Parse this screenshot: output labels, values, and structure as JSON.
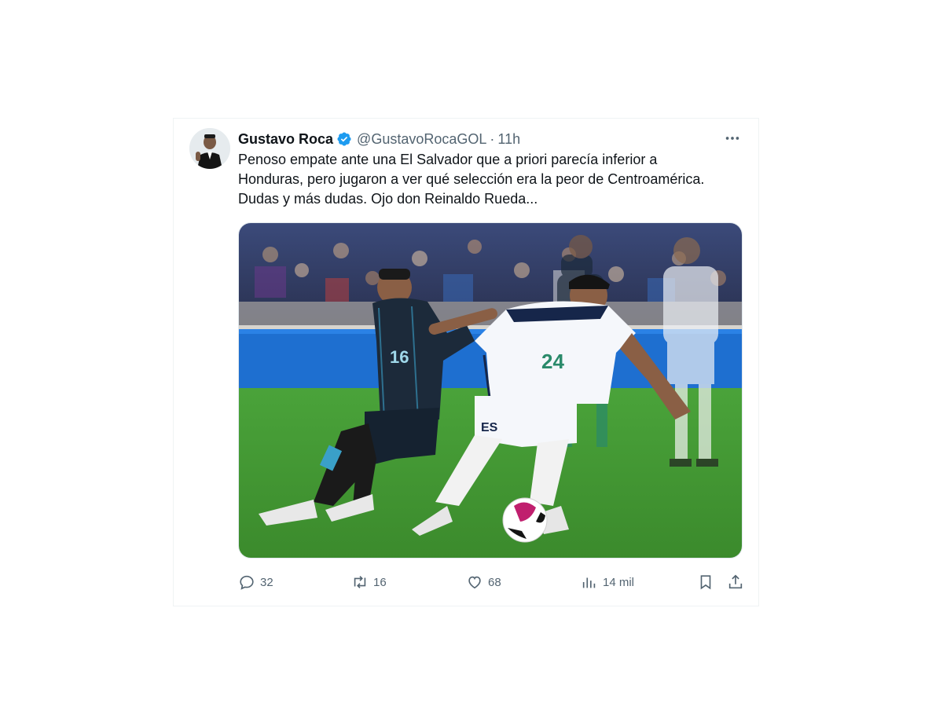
{
  "tweet": {
    "author_name": "Gustavo Roca",
    "handle": "@GustavoRocaGOL",
    "separator": "·",
    "time": "11h",
    "text_lines": [
      "Penoso empate ante una El Salvador que a priori parecía inferior a",
      "Honduras, pero jugaron a ver qué selección era la peor de Centroamérica.",
      "Dudas y más dudas. Ojo don Reinaldo Rueda..."
    ],
    "media_jersey_numbers": {
      "honduras_player": "16",
      "salvador_player": "24"
    }
  },
  "actions": {
    "replies": "32",
    "retweets": "16",
    "likes": "68",
    "views": "14 mil"
  },
  "icons": {
    "verified": "verified-badge-icon",
    "more": "more-options-icon",
    "reply": "reply-icon",
    "retweet": "retweet-icon",
    "like": "like-icon",
    "views": "views-icon",
    "bookmark": "bookmark-icon",
    "share": "share-icon"
  },
  "colors": {
    "verified_blue": "#1d9bf0",
    "text_secondary": "#536471",
    "pitch_green": "#3f8f2d",
    "honduras_kit": "#1c2a3a",
    "salvador_kit": "#f5f7fb"
  }
}
